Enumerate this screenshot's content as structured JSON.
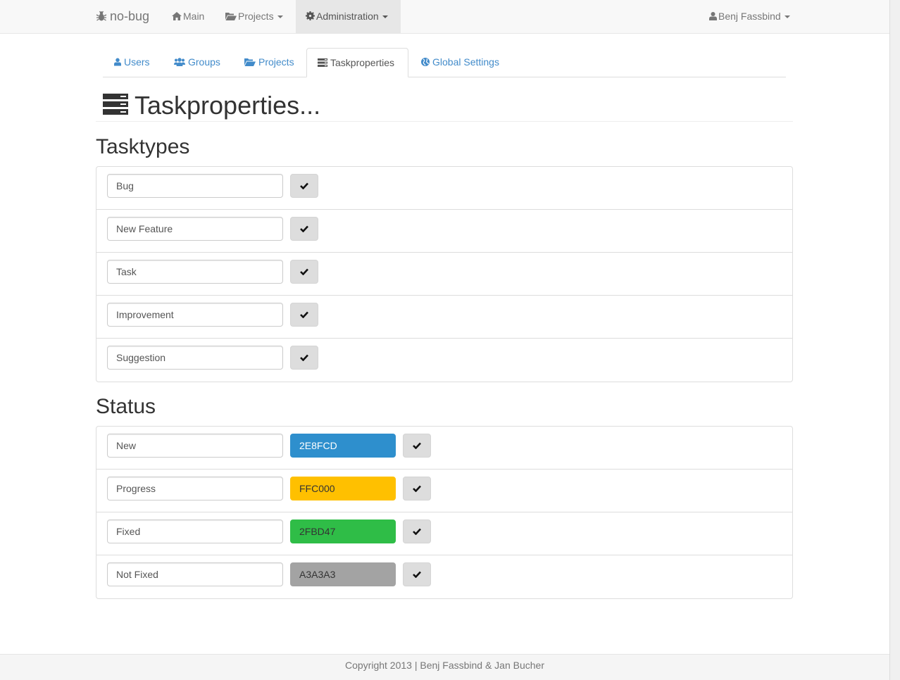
{
  "navbar": {
    "brand": "no-bug",
    "main": "Main",
    "projects": "Projects",
    "administration": "Administration",
    "user": "Benj Fassbind"
  },
  "tabs": {
    "users": "Users",
    "groups": "Groups",
    "projects": "Projects",
    "taskproperties": "Taskproperties",
    "global_settings": "Global Settings"
  },
  "page": {
    "title": "Taskproperties..."
  },
  "tasktypes": {
    "heading": "Tasktypes",
    "items": [
      {
        "value": "Bug"
      },
      {
        "value": "New Feature"
      },
      {
        "value": "Task"
      },
      {
        "value": "Improvement"
      },
      {
        "value": "Suggestion"
      }
    ]
  },
  "status": {
    "heading": "Status",
    "items": [
      {
        "value": "New",
        "color": "2E8FCD",
        "bg": "#2e8fcd",
        "fg": "#ffffff"
      },
      {
        "value": "Progress",
        "color": "FFC000",
        "bg": "#ffc000",
        "fg": "#333333"
      },
      {
        "value": "Fixed",
        "color": "2FBD47",
        "bg": "#2fbd47",
        "fg": "#333333"
      },
      {
        "value": "Not Fixed",
        "color": "A3A3A3",
        "bg": "#a3a3a3",
        "fg": "#333333"
      }
    ]
  },
  "footer": {
    "text": "Copyright 2013 | Benj Fassbind & Jan Bucher"
  }
}
